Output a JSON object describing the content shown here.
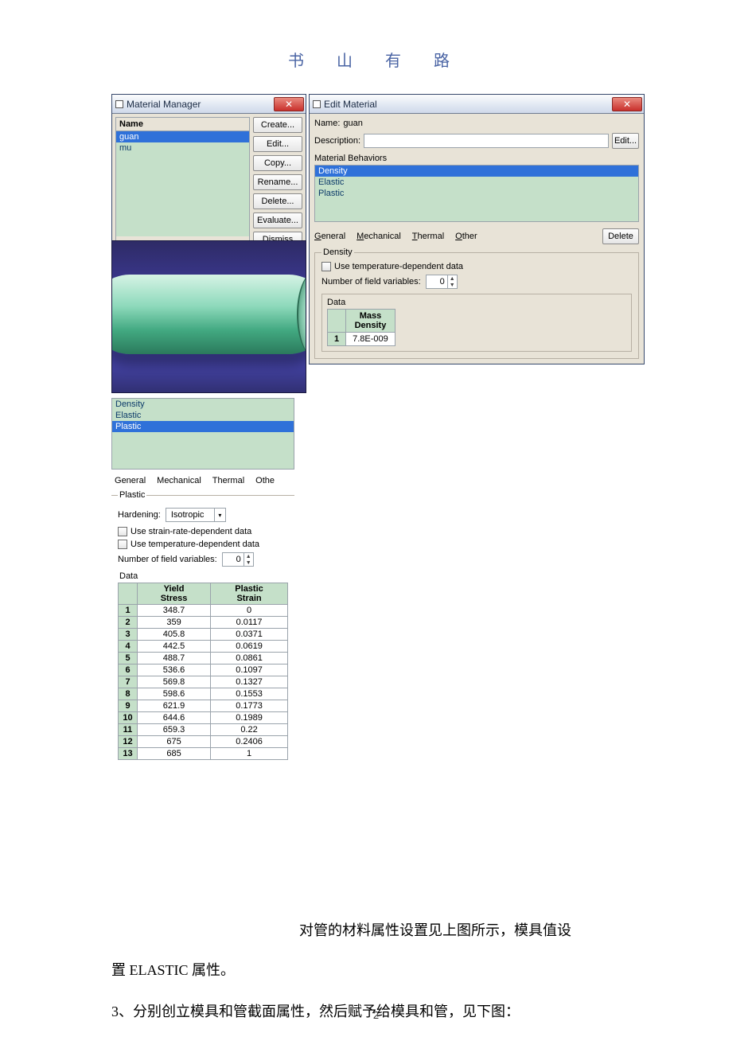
{
  "page_header": "书  山  有  路",
  "page_number": "2",
  "material_manager": {
    "title": "Material Manager",
    "list_header": "Name",
    "items": [
      "guan",
      "mu"
    ],
    "selected_index": 0,
    "buttons": {
      "create": "Create...",
      "edit": "Edit...",
      "copy": "Copy...",
      "rename": "Rename...",
      "delete": "Delete...",
      "evaluate": "Evaluate...",
      "dismiss": "Dismiss"
    }
  },
  "edit_material": {
    "title": "Edit Material",
    "name_label": "Name:",
    "name_value": "guan",
    "desc_label": "Description:",
    "edit_btn": "Edit...",
    "behaviors_label": "Material Behaviors",
    "behaviors": [
      "Density",
      "Elastic",
      "Plastic"
    ],
    "behaviors_selected": 0,
    "menus": {
      "general": "General",
      "mechanical": "Mechanical",
      "thermal": "Thermal",
      "other": "Other"
    },
    "delete_btn": "Delete",
    "density_section": {
      "legend": "Density",
      "temp_dep": "Use temperature-dependent data",
      "nfv_label": "Number of field variables:",
      "nfv_value": "0",
      "data_label": "Data",
      "table_header": "Mass\nDensity",
      "rows": [
        {
          "idx": "1",
          "value": "7.8E-009"
        }
      ]
    }
  },
  "plastic_panel": {
    "behaviors": [
      "Density",
      "Elastic",
      "Plastic"
    ],
    "behaviors_selected": 2,
    "menus": {
      "general": "General",
      "mechanical": "Mechanical",
      "thermal": "Thermal",
      "other": "Othe"
    },
    "legend": "Plastic",
    "hardening_label": "Hardening:",
    "hardening_value": "Isotropic",
    "strain_rate_dep": "Use strain-rate-dependent data",
    "temp_dep": "Use temperature-dependent data",
    "nfv_label": "Number of field variables:",
    "nfv_value": "0",
    "data_label": "Data",
    "headers": {
      "col1": "Yield\nStress",
      "col2": "Plastic\nStrain"
    },
    "rows": [
      {
        "idx": "1",
        "ys": "348.7",
        "ps": "0"
      },
      {
        "idx": "2",
        "ys": "359",
        "ps": "0.0117"
      },
      {
        "idx": "3",
        "ys": "405.8",
        "ps": "0.0371"
      },
      {
        "idx": "4",
        "ys": "442.5",
        "ps": "0.0619"
      },
      {
        "idx": "5",
        "ys": "488.7",
        "ps": "0.0861"
      },
      {
        "idx": "6",
        "ys": "536.6",
        "ps": "0.1097"
      },
      {
        "idx": "7",
        "ys": "569.8",
        "ps": "0.1327"
      },
      {
        "idx": "8",
        "ys": "598.6",
        "ps": "0.1553"
      },
      {
        "idx": "9",
        "ys": "621.9",
        "ps": "0.1773"
      },
      {
        "idx": "10",
        "ys": "644.6",
        "ps": "0.1989"
      },
      {
        "idx": "11",
        "ys": "659.3",
        "ps": "0.22"
      },
      {
        "idx": "12",
        "ys": "675",
        "ps": "0.2406"
      },
      {
        "idx": "13",
        "ys": "685",
        "ps": "1"
      }
    ]
  },
  "body_text": {
    "line1": "对管的材料属性设置见上图所示，模具值设",
    "line2": "置 ELASTIC 属性。",
    "line3": "3、分别创立模具和管截面属性，然后赋予给模具和管，见下图："
  }
}
